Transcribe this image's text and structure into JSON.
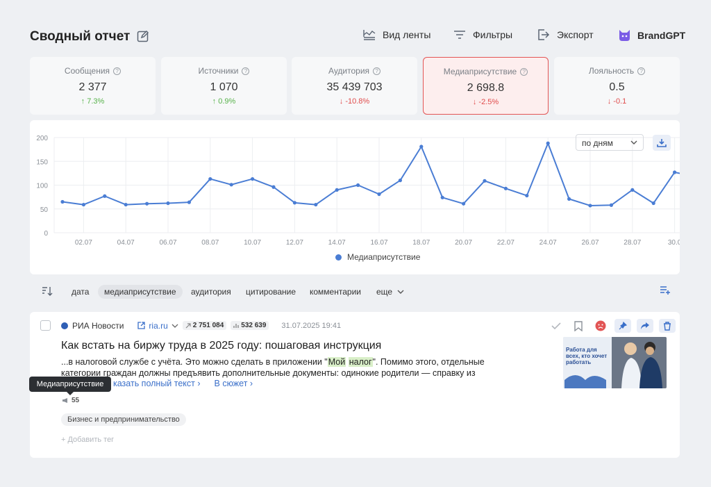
{
  "header": {
    "title": "Сводный отчет",
    "feed_view": "Вид ленты",
    "filters": "Фильтры",
    "export": "Экспорт",
    "brand": "BrandGPT"
  },
  "kpis": [
    {
      "label": "Сообщения",
      "value": "2 377",
      "delta": "↑ 7.3%",
      "dir": "up"
    },
    {
      "label": "Источники",
      "value": "1 070",
      "delta": "↑ 0.9%",
      "dir": "up"
    },
    {
      "label": "Аудитория",
      "value": "35 439 703",
      "delta": "↓ -10.8%",
      "dir": "down"
    },
    {
      "label": "Медиаприсутствие",
      "value": "2 698.8",
      "delta": "↓ -2.5%",
      "dir": "down"
    },
    {
      "label": "Лояльность",
      "value": "0.5",
      "delta": "↓ -0.1",
      "dir": "down"
    }
  ],
  "chart_controls": {
    "period": "по дням"
  },
  "chart_data": {
    "type": "line",
    "x": [
      "01.07",
      "02.07",
      "03.07",
      "04.07",
      "05.07",
      "06.07",
      "07.07",
      "08.07",
      "09.07",
      "10.07",
      "11.07",
      "12.07",
      "13.07",
      "14.07",
      "15.07",
      "16.07",
      "17.07",
      "18.07",
      "19.07",
      "20.07",
      "21.07",
      "22.07",
      "23.07",
      "24.07",
      "25.07",
      "26.07",
      "27.07",
      "28.07",
      "29.07",
      "30.07",
      "31.07"
    ],
    "tick_labels": [
      "02.07",
      "04.07",
      "06.07",
      "08.07",
      "10.07",
      "12.07",
      "14.07",
      "16.07",
      "18.07",
      "20.07",
      "22.07",
      "24.07",
      "26.07",
      "28.07",
      "30.0"
    ],
    "series": [
      {
        "name": "Медиаприсутствие",
        "color": "#4a7dd4",
        "values": [
          65,
          59,
          77,
          59,
          61,
          62,
          64,
          113,
          101,
          113,
          96,
          63,
          59,
          90,
          100,
          81,
          110,
          181,
          74,
          61,
          109,
          93,
          78,
          188,
          71,
          57,
          58,
          90,
          62,
          127,
          118
        ]
      }
    ],
    "yticks": [
      0,
      50,
      100,
      150,
      200
    ],
    "ylim": [
      0,
      200
    ],
    "grid": true,
    "legend": "bottom"
  },
  "sort": {
    "items": [
      "дата",
      "медиаприсутствие",
      "аудитория",
      "цитирование",
      "комментарии",
      "еще"
    ],
    "active": "медиаприсутствие"
  },
  "article": {
    "source": "РИА Новости",
    "site": "ria.ru",
    "reach": "2 751 084",
    "views": "532 639",
    "date": "31.07.2025 19:41",
    "headline": "Как встать на биржу труда в 2025 году: пошаговая инструкция",
    "snippet_before": "...в налоговой службе с учёта. Это можно сделать в приложении \"",
    "hl1": "Мой",
    "hl2": "налог",
    "snippet_after": "\". Помимо этого, отдельные категории граждан должны предъявить дополнительные документы: одинокие родители — справку из",
    "show_full": "казать полный текст ›",
    "to_story": "В сюжет ›",
    "metric": "55",
    "tag": "Бизнес и предпринимательство",
    "add_tag": "+  Добавить тег",
    "thumb_text": "Работа для всех, кто хочет работать"
  },
  "tooltip": "Медиаприсутствие"
}
